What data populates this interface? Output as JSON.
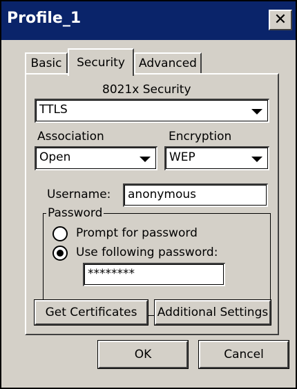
{
  "window": {
    "title": "Profile_1",
    "close_glyph": "✕"
  },
  "tabs": [
    {
      "label": "Basic",
      "selected": false
    },
    {
      "label": "Security",
      "selected": true
    },
    {
      "label": "Advanced",
      "selected": false
    }
  ],
  "security": {
    "heading": "8021x Security",
    "eap_value": "TTLS",
    "association_label": "Association",
    "association_value": "Open",
    "encryption_label": "Encryption",
    "encryption_value": "WEP",
    "username_label": "Username:",
    "username_value": "anonymous",
    "password_group_label": "Password",
    "radio_prompt_label": "Prompt for password",
    "radio_use_label": "Use following password:",
    "selected_password_option": "Use following password:",
    "password_value": "********",
    "get_certificates_label": "Get Certificates",
    "additional_settings_label": "Additional Settings"
  },
  "footer": {
    "ok_label": "OK",
    "cancel_label": "Cancel"
  },
  "colors": {
    "title_bar": "#0a246a",
    "face": "#d4d0c8"
  }
}
